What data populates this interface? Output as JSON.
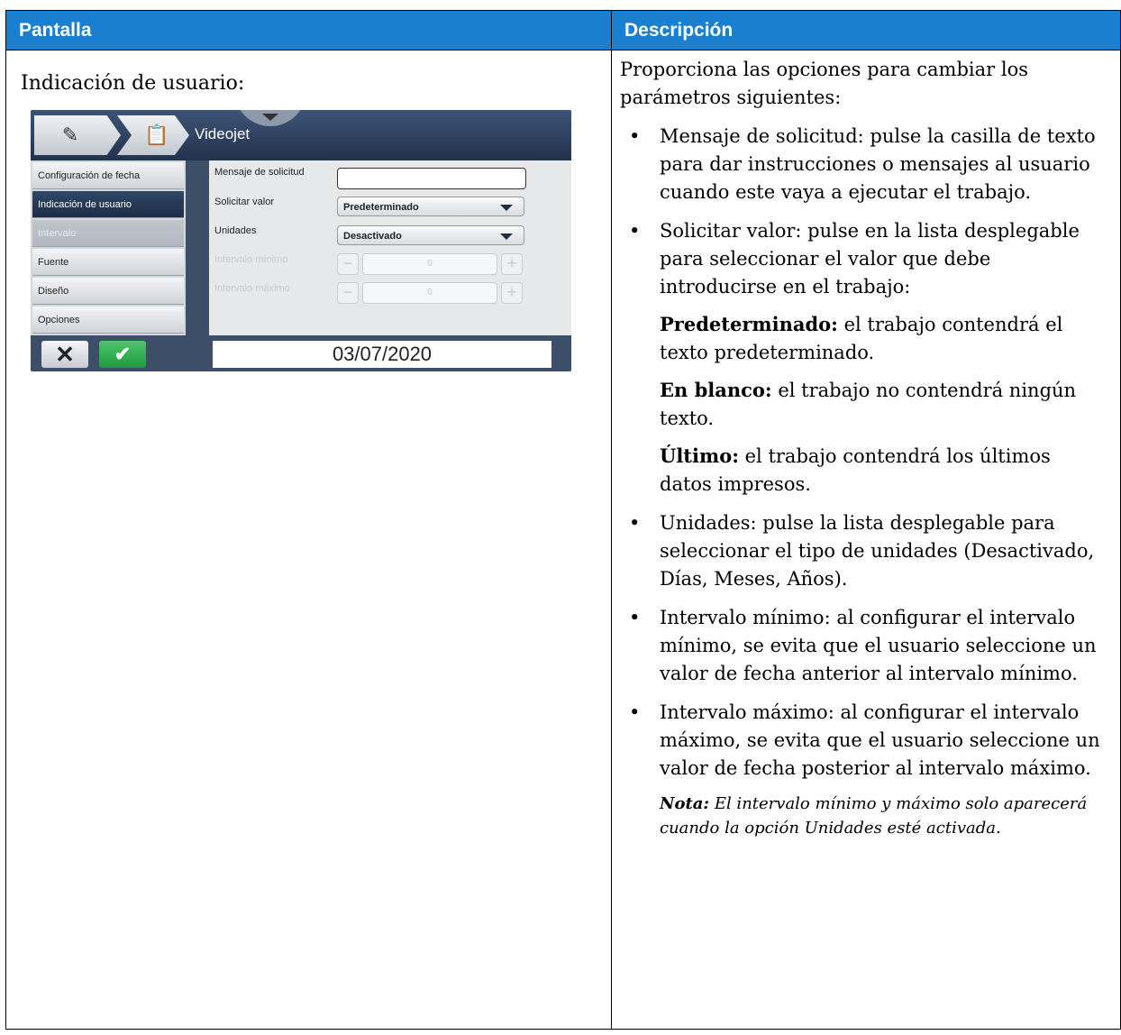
{
  "header": {
    "left": "Pantalla",
    "right": "Descripción"
  },
  "left_cell": {
    "title": "Indicación de usuario:"
  },
  "screenshot": {
    "app_title": "Videojet",
    "sidebar": [
      {
        "label": "Configuración de fecha",
        "state": "normal"
      },
      {
        "label": "Indicación de usuario",
        "state": "active"
      },
      {
        "label": "Intervalo",
        "state": "disabled"
      },
      {
        "label": "Fuente",
        "state": "normal"
      },
      {
        "label": "Diseño",
        "state": "normal"
      },
      {
        "label": "Opciones",
        "state": "normal"
      }
    ],
    "fields": {
      "mensaje_label": "Mensaje de solicitud",
      "mensaje_value": "",
      "solicitar_label": "Solicitar valor",
      "solicitar_value": "Predeterminado",
      "unidades_label": "Unidades",
      "unidades_value": "Desactivado",
      "min_label": "Intervalo mínimo",
      "min_value": "0",
      "max_label": "Intervalo máximo",
      "max_value": "0"
    },
    "date": "03/07/2020"
  },
  "description": {
    "intro": "Proporciona las opciones para cambiar los parámetros siguientes:",
    "bullet1": "Mensaje de solicitud: pulse la casilla de texto para dar instrucciones o mensajes al usuario cuando este vaya a ejecutar el trabajo.",
    "bullet2": "Solicitar valor: pulse en la lista desplegable para seleccionar el valor que debe introducirse en el trabajo:",
    "opt1_bold": "Predeterminado:",
    "opt1_text": " el trabajo contendrá el texto predeterminado.",
    "opt2_bold": "En blanco:",
    "opt2_text": " el trabajo no contendrá ningún texto.",
    "opt3_bold": "Último:",
    "opt3_text": " el trabajo contendrá los últimos datos impresos.",
    "bullet3": "Unidades: pulse la lista desplegable para seleccionar el tipo de unidades (Desactivado, Días, Meses, Años).",
    "bullet4": "Intervalo mínimo: al configurar el intervalo mínimo, se evita que el usuario seleccione un valor de fecha anterior al intervalo mínimo.",
    "bullet5": "Intervalo máximo: al configurar el intervalo máximo, se evita que el usuario seleccione un valor de fecha posterior al intervalo máximo.",
    "note_bold": "Nota:",
    "note_text": " El intervalo mínimo y máximo solo aparecerá cuando la opción Unidades esté activada.",
    "bullet_glyph": "•"
  }
}
